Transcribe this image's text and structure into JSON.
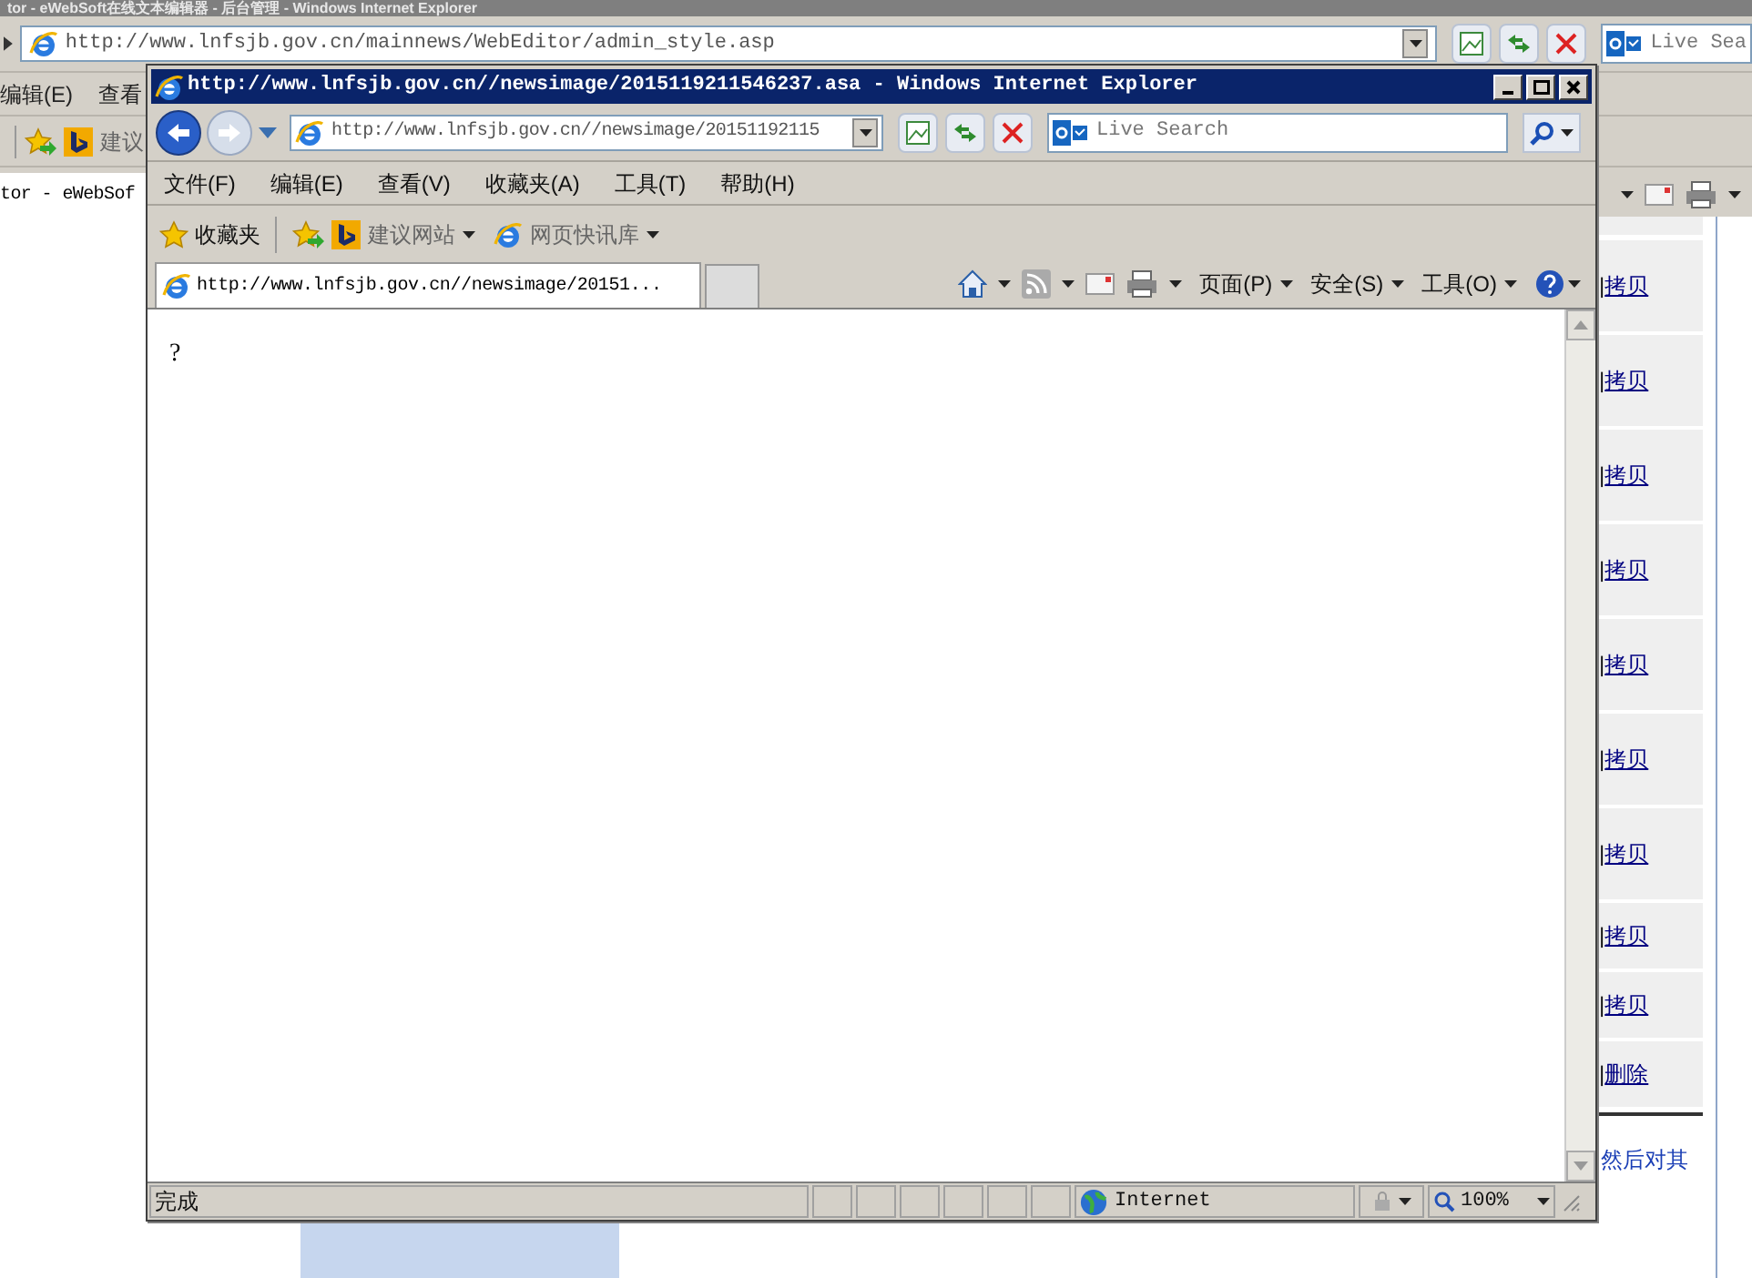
{
  "background_window": {
    "title": "tor - eWebSoft在线文本编辑器 - 后台管理 - Windows Internet Explorer",
    "address": "http://www.lnfsjb.gov.cn/mainnews/WebEditor/admin_style.asp",
    "search_placeholder": "Live Sea",
    "menu": [
      "编辑(E)",
      "查看"
    ],
    "favorites_item": "建议",
    "tab": "tor - eWebSof",
    "rows": [
      {
        "separator": "|",
        "link": "拷贝"
      },
      {
        "separator": "|",
        "link": "拷贝"
      },
      {
        "separator": "|",
        "link": "拷贝"
      },
      {
        "separator": "|",
        "link": "拷贝"
      },
      {
        "separator": "|",
        "link": "拷贝"
      },
      {
        "separator": "|",
        "link": "拷贝"
      },
      {
        "separator": "|",
        "link": "拷贝"
      },
      {
        "separator": "|",
        "link": "拷贝"
      },
      {
        "separator": "|",
        "link": "拷贝"
      },
      {
        "separator": "|",
        "link": "删除"
      }
    ],
    "note": "然后对其"
  },
  "popup": {
    "title": "http://www.lnfsjb.gov.cn//newsimage/2015119211546237.asa - Windows Internet Explorer",
    "address": "http://www.lnfsjb.gov.cn//newsimage/20151192115",
    "search_placeholder": "Live Search",
    "menu": [
      "文件(F)",
      "编辑(E)",
      "查看(V)",
      "收藏夹(A)",
      "工具(T)",
      "帮助(H)"
    ],
    "favorites": {
      "label": "收藏夹",
      "links": [
        "建议网站",
        "网页快讯库"
      ]
    },
    "tabs": [
      {
        "label": "http://www.lnfsjb.gov.cn//newsimage/20151...",
        "selected": true
      }
    ],
    "commands": [
      "页面(P)",
      "安全(S)",
      "工具(O)"
    ],
    "content": "?",
    "status": {
      "text": "完成",
      "zone": "Internet",
      "zoom": "100%"
    }
  }
}
